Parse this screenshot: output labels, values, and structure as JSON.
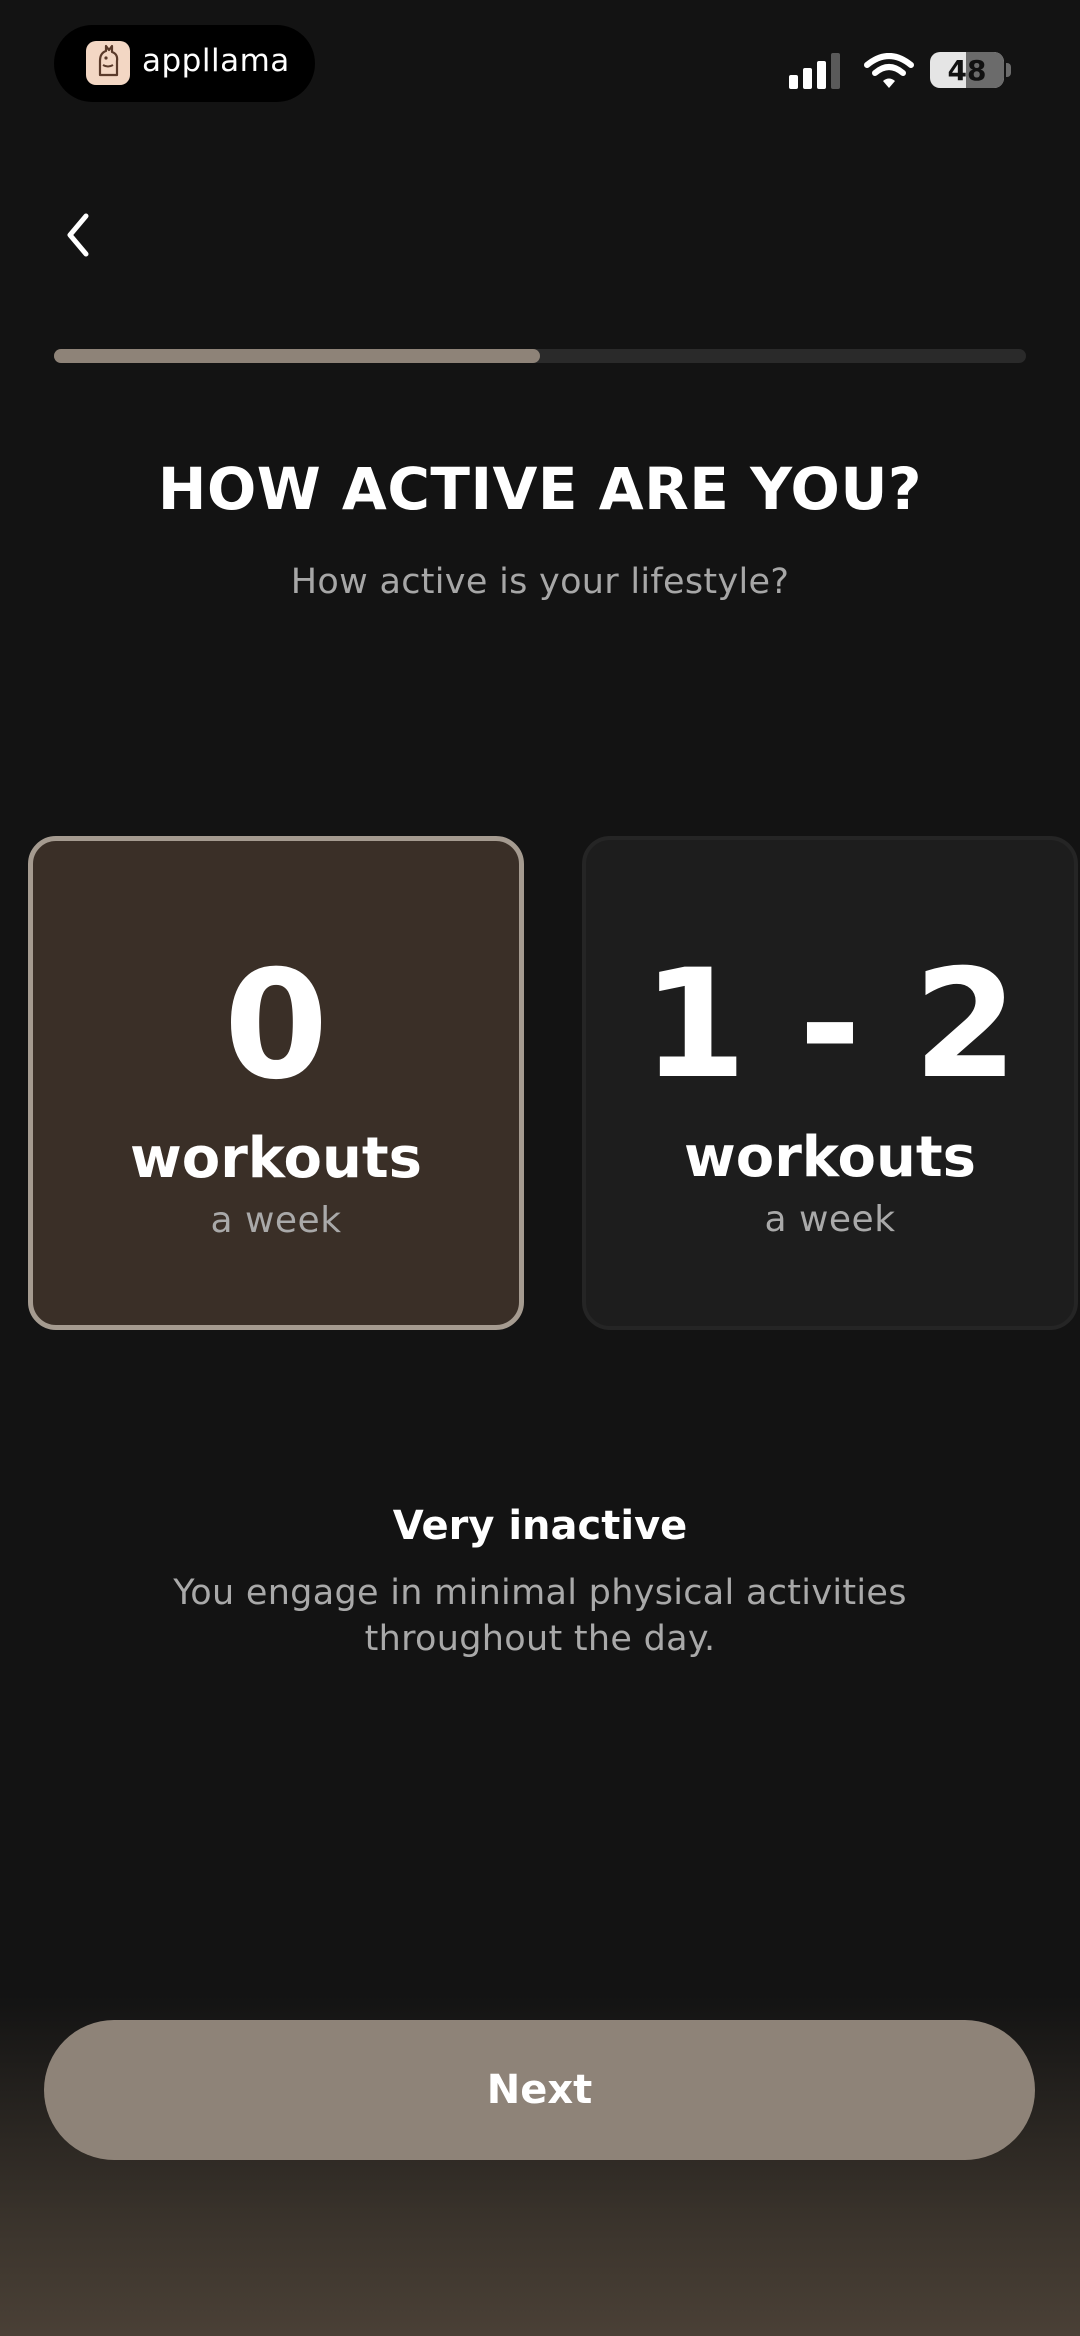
{
  "status_bar": {
    "recorder_name": "appllama",
    "battery_level": "48",
    "battery_fraction": 0.48
  },
  "icons": {
    "back": "chevron-left-icon",
    "signal": "signal-bars-icon",
    "wifi": "wifi-icon",
    "battery": "battery-icon",
    "logo": "llama-logo-icon"
  },
  "progress": {
    "fraction": 0.5
  },
  "header": {
    "title": "HOW ACTIVE ARE YOU?",
    "subtitle": "How active is your lifestyle?"
  },
  "options": [
    {
      "number": "0",
      "unit": "workouts",
      "frequency": "a week",
      "selected": true
    },
    {
      "number": "1 - 2",
      "unit": "workouts",
      "frequency": "a week",
      "selected": false
    }
  ],
  "selected_level": {
    "title": "Very inactive",
    "description": "You engage in minimal physical activities throughout the day."
  },
  "footer": {
    "next_label": "Next"
  },
  "colors": {
    "background": "#131313",
    "accent": "#8e8378",
    "selected_card": "#3a2f27",
    "selected_border": "#a59b90",
    "card": "#1d1d1d",
    "muted_text": "#a7a7a7"
  }
}
